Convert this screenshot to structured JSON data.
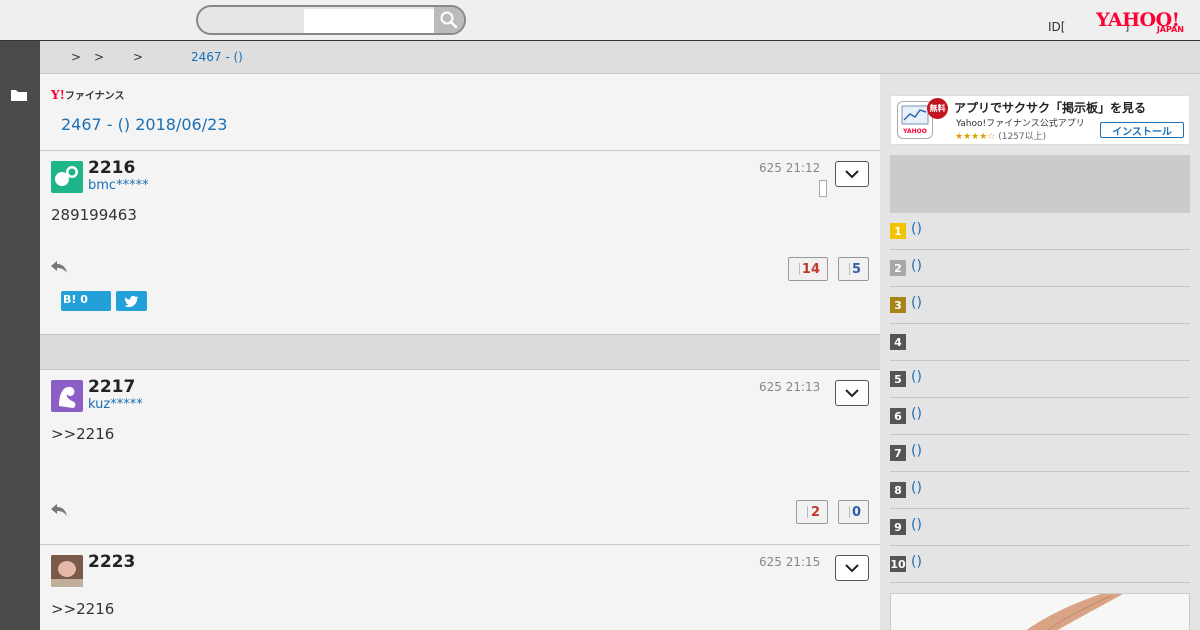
{
  "header": {
    "search_placeholder": "",
    "id_link": "ID[",
    "mini_mark": "]",
    "logo_main": "YAHOO!",
    "logo_sub": "JAPAN",
    "icons": {
      "search": "search-icon",
      "folder": "folder-icon"
    }
  },
  "breadcrumb": {
    "separators": [
      ">",
      ">",
      ">"
    ],
    "current": "2467 - ()"
  },
  "board": {
    "logo_y": "Y!",
    "logo_text": "ファイナンス",
    "title": "2467 - () 2018/06/23"
  },
  "posts": [
    {
      "number": "2216",
      "user": "bmc*****",
      "time": "625 21:12",
      "body": "289199463",
      "likes": "14",
      "dislikes": "5",
      "hatena_label": "B!",
      "hatena_count": "0",
      "avatar_color": "#1fb58a"
    },
    {
      "number": "2217",
      "user": "kuz*****",
      "time": "625 21:13",
      "body": ">>2216",
      "likes": "2",
      "dislikes": "0",
      "avatar_color": "#8c5fc7"
    },
    {
      "number": "2223",
      "user": "",
      "time": "625 21:15",
      "body": ">>2216",
      "avatar_color": "#a07a6a"
    }
  ],
  "sidebar": {
    "app_banner": {
      "badge": "無料",
      "title": "アプリでサクサク「掲示板」を見る",
      "subtitle": "Yahoo!ファイナンス公式アプリ",
      "stars": "★★★★☆",
      "rating_count": "(1257以上)",
      "install_label": "インストール"
    },
    "ranking": [
      {
        "rank": "1",
        "text": "()",
        "color": "#f2c300"
      },
      {
        "rank": "2",
        "text": "()",
        "color": "#a8a8a8"
      },
      {
        "rank": "3",
        "text": "()",
        "color": "#a68418"
      },
      {
        "rank": "4",
        "text": "",
        "color": "#555555"
      },
      {
        "rank": "5",
        "text": "()",
        "color": "#555555"
      },
      {
        "rank": "6",
        "text": "()",
        "color": "#555555"
      },
      {
        "rank": "7",
        "text": "()",
        "color": "#555555"
      },
      {
        "rank": "8",
        "text": "()",
        "color": "#555555"
      },
      {
        "rank": "9",
        "text": "()",
        "color": "#555555"
      },
      {
        "rank": "10",
        "text": "()",
        "color": "#555555"
      }
    ]
  },
  "colors": {
    "link_blue": "#1a6fb5",
    "like_red": "#c0392b",
    "dislike_blue": "#2d5fa8",
    "yahoo_red": "#ff0033",
    "nav_dark": "#4a4a4a"
  }
}
